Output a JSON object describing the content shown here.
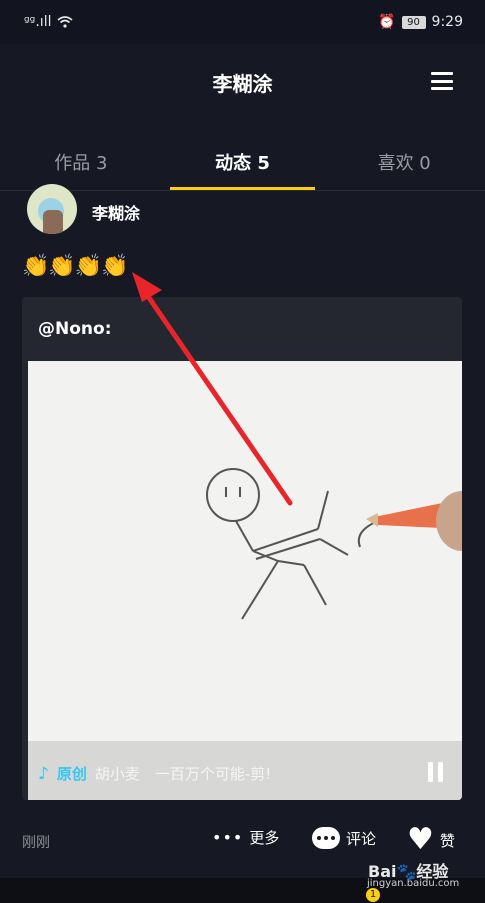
{
  "status_bar": {
    "signal": "ᵍᵍ.ıll",
    "time": "9:29",
    "battery": "90"
  },
  "header": {
    "title": "李糊涂"
  },
  "tabs": [
    {
      "label": "作品 3"
    },
    {
      "label": "动态 5"
    },
    {
      "label": "喜欢 0"
    }
  ],
  "post": {
    "username": "李糊涂",
    "emoji": "👏👏👏👏",
    "mention": "@Nono:",
    "music": {
      "original_label": "原创",
      "info": "胡小麦　一百万个可能-剪!"
    }
  },
  "footer": {
    "time": "刚刚",
    "more_label": "更多",
    "comment_label": "评论",
    "like_label": "赞"
  },
  "watermark": {
    "brand": "Bai🐾经验",
    "url": "jingyan.baidu.com"
  },
  "badge": "1",
  "colors": {
    "background": "#161823",
    "accent": "#face15",
    "arrow": "#e8252a",
    "music": "#35c7f0"
  }
}
